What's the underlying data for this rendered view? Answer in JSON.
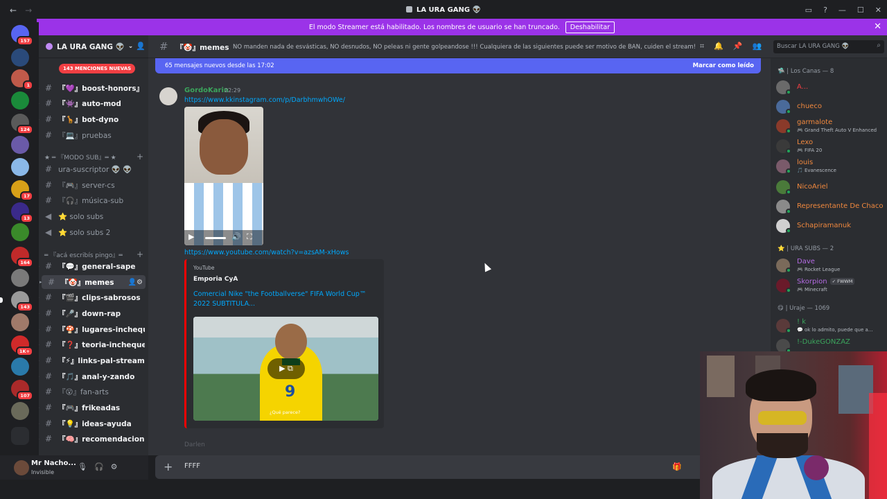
{
  "window": {
    "title": "LA URA GANG 👽",
    "nav_back": "←",
    "nav_forward": "→",
    "controls": [
      "▭",
      "?",
      "—",
      "☐",
      "✕"
    ]
  },
  "banner": {
    "text": "El modo Streamer está habilitado. Los nombres de usuario se han truncado.",
    "button": "Deshabilitar",
    "close": "✕"
  },
  "servers": {
    "badges": [
      "157",
      "1",
      "124",
      "17",
      "13",
      "164",
      "143",
      "1K+",
      "107"
    ]
  },
  "guild": {
    "name": "LA URA GANG 👽",
    "mentions_pill": "143 MENCIONES NUEVAS"
  },
  "channels": [
    {
      "name": "『💜』boost-honors』",
      "unread": true
    },
    {
      "name": "『👾』auto-mod",
      "unread": true
    },
    {
      "name": "『🦒』bot-dyno",
      "unread": true
    },
    {
      "name": "『💻』pruebas",
      "unread": false
    },
    {
      "name": "ura-suscriptor 👽 👽",
      "unread": false
    },
    {
      "name": "『🎮』server-cs",
      "unread": false
    },
    {
      "name": "『🎧』música-sub",
      "unread": false
    },
    {
      "name": "⭐ solo subs",
      "unread": false
    },
    {
      "name": "⭐ solo subs 2",
      "unread": false
    },
    {
      "name": "『💬』general-sape",
      "unread": true
    },
    {
      "name": "『🤡』memes",
      "unread": true
    },
    {
      "name": "『🎬』clips-sabrosos",
      "unread": true
    },
    {
      "name": "『🎤』down-rap",
      "unread": true
    },
    {
      "name": "『🍄』lugares-inchequ...",
      "unread": true
    },
    {
      "name": "『❓』teoria-inchequea...",
      "unread": true
    },
    {
      "name": "『⚡』links-pal-stream",
      "unread": true
    },
    {
      "name": "『🎵』anal-y-zando",
      "unread": true
    },
    {
      "name": "『😮』fan-arts",
      "unread": false
    },
    {
      "name": "『🎮』frikeadas",
      "unread": true
    },
    {
      "name": "『💡』ideas-ayuda",
      "unread": true
    },
    {
      "name": "『🧠』recomendaciones",
      "unread": true
    }
  ],
  "categories": {
    "modo_sub": "★ ═ 『MODO SUB』═ ★",
    "acá": "═ 『acá escribís pingo』═"
  },
  "user": {
    "name": "Mr Nacho...",
    "status": "Invisible"
  },
  "header": {
    "channel": "『🤡』memes",
    "topic": "NO manden nada de esvásticas, NO desnudos, NO peleas ni gente golpeandose !!! Cualquiera de las siguientes puede ser motivo de BAN, cuiden el stream!",
    "search_placeholder": "Buscar LA URA GANG 👽"
  },
  "chat": {
    "new_messages": "65 mensajes nuevos desde las 17:02",
    "mark_read": "Marcar como leído",
    "message": {
      "author": "GordoKarin",
      "time": "22:29",
      "link1": "https://www.kkinstagram.com/p/DarbhmwhOWe/",
      "link2": "https://www.youtube.com/watch?v=azsAM-xHows"
    },
    "embed": {
      "provider": "YouTube",
      "author": "Emporia CyA",
      "title": "Comercial Nike \"the Footballverse\" FIFA World Cup™ 2022 SUBTITULA...",
      "subtitle": "¿Qué parece?"
    },
    "next_author": "Darlen",
    "composer_text": "FFFF"
  },
  "members": {
    "categories": [
      {
        "label": "🛸 | Los Canas — 8"
      },
      {
        "label": "⭐ | URA SUBS — 2"
      },
      {
        "label": "😋 | Uraje — 1069"
      }
    ],
    "list": [
      {
        "name": "A...",
        "activity": "",
        "color": "#f23f43",
        "av": "#6a6a6a"
      },
      {
        "name": "chueco",
        "activity": "",
        "color": "#f0883e",
        "av": "#4a6a9a"
      },
      {
        "name": "garmalote",
        "activity": "🎮 Grand Theft Auto V Enhanced",
        "color": "#f0883e",
        "av": "#8a3a2a"
      },
      {
        "name": "Lexo",
        "activity": "🎮 FIFA 20",
        "color": "#f0883e",
        "av": "#3a3a3a"
      },
      {
        "name": "louis",
        "activity": "🎵 Evanescence",
        "color": "#f0883e",
        "av": "#7a5a6a"
      },
      {
        "name": "NicoAriel",
        "activity": "",
        "color": "#f0883e",
        "av": "#4a7a3a"
      },
      {
        "name": "Representante De Chaco",
        "activity": "",
        "color": "#f0883e",
        "av": "#8a8a8a"
      },
      {
        "name": "Schapiramanuk",
        "activity": "",
        "color": "#f0883e",
        "av": "#d0d0d0"
      },
      {
        "name": "Dave",
        "activity": "🎮 Rocket League",
        "color": "#b36ae2",
        "av": "#7a6a5a"
      },
      {
        "name": "Skorpion",
        "activity": "🎮 Minecraft",
        "color": "#b36ae2",
        "av": "#6a1a2a",
        "tag": "✓ FWWM"
      },
      {
        "name": "! k",
        "activity": "💬 ok lo admito, puede que a...",
        "color": "#3ba55c",
        "av": "#5a3a3a"
      },
      {
        "name": "!-DukeGONZAZ",
        "activity": "",
        "color": "#3ba55c",
        "av": "#4a4a4a"
      }
    ]
  },
  "colors": {
    "banner": "#9b33e8",
    "accent": "#5865f2",
    "link": "#00a8fc",
    "online": "#23a55a"
  }
}
